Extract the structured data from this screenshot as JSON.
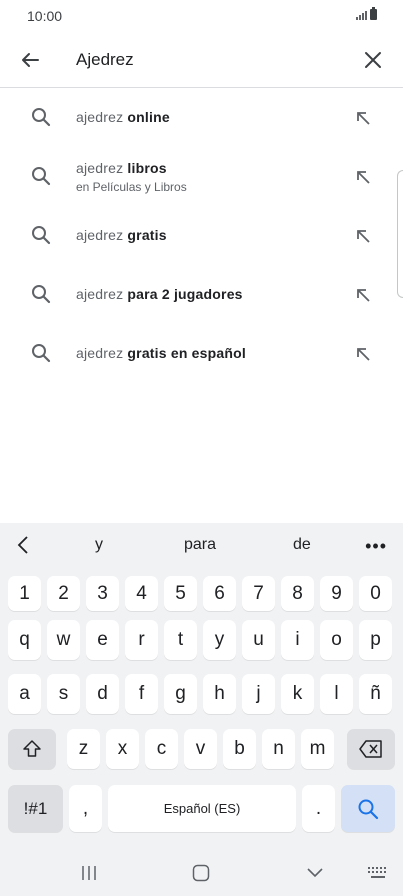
{
  "status": {
    "time": "10:00"
  },
  "search": {
    "query": "Ajedrez"
  },
  "suggestions": [
    {
      "prefix": "ajedrez",
      "suffix": "online",
      "sub": ""
    },
    {
      "prefix": "ajedrez",
      "suffix": "libros",
      "sub": "en Películas y Libros"
    },
    {
      "prefix": "ajedrez",
      "suffix": "gratis",
      "sub": ""
    },
    {
      "prefix": "ajedrez",
      "suffix": "para 2 jugadores",
      "sub": ""
    },
    {
      "prefix": "ajedrez",
      "suffix": "gratis en español",
      "sub": ""
    }
  ],
  "keyboard": {
    "predictions": [
      "y",
      "para",
      "de"
    ],
    "more": "•••",
    "numbers": [
      "1",
      "2",
      "3",
      "4",
      "5",
      "6",
      "7",
      "8",
      "9",
      "0"
    ],
    "row1": [
      "q",
      "w",
      "e",
      "r",
      "t",
      "y",
      "u",
      "i",
      "o",
      "p"
    ],
    "row2": [
      "a",
      "s",
      "d",
      "f",
      "g",
      "h",
      "j",
      "k",
      "l",
      "ñ"
    ],
    "row3": [
      "z",
      "x",
      "c",
      "v",
      "b",
      "n",
      "m"
    ],
    "symbols": "!#1",
    "comma": ",",
    "space": "Español (ES)",
    "period": "."
  },
  "colors": {
    "accent": "#1a73e8",
    "icon": "#5f6368",
    "keyboard_bg": "#f1f2f4"
  }
}
